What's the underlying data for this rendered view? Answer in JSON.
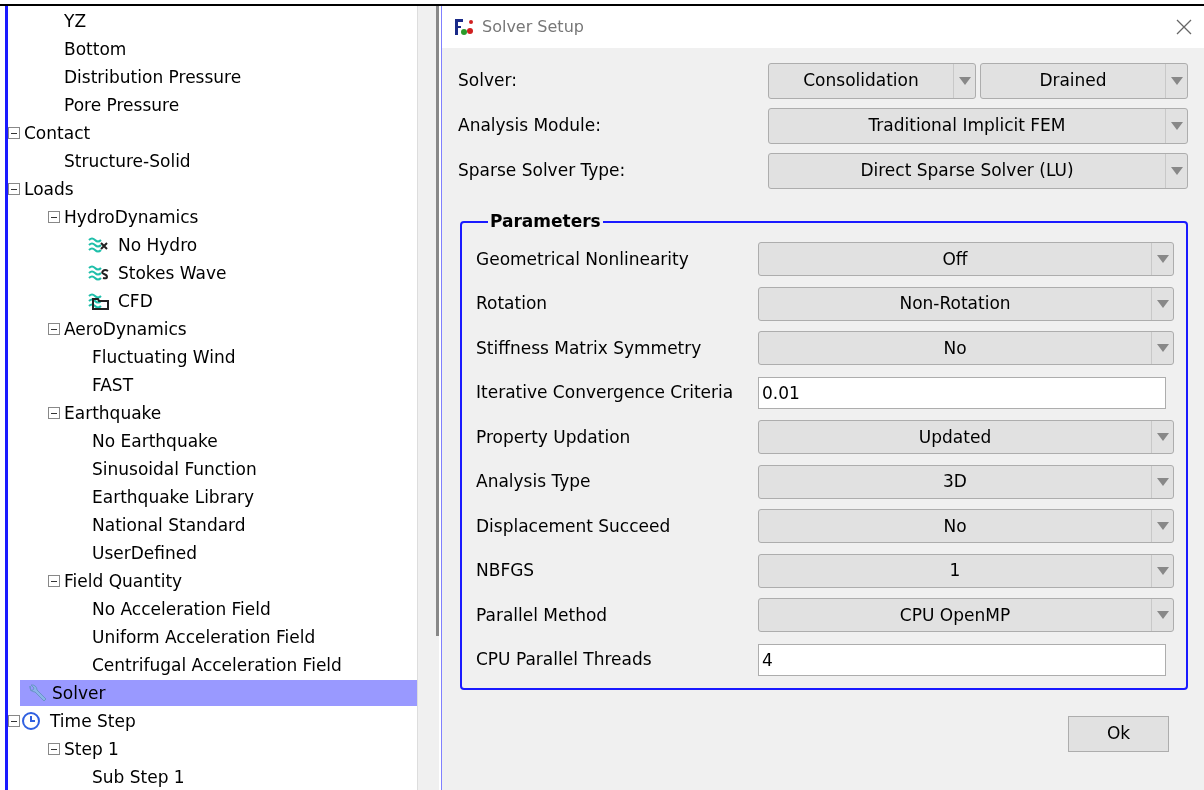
{
  "tree": [
    {
      "children": [
        {
          "label": "YZ",
          "selected": false
        },
        {
          "label": "Bottom",
          "selected": false
        },
        {
          "label": "Distribution Pressure",
          "selected": false
        },
        {
          "label": "Pore Pressure",
          "selected": false
        }
      ]
    },
    {
      "label": "Contact",
      "selected": false,
      "expanded": true,
      "children": [
        {
          "label": "Structure-Solid",
          "selected": false
        }
      ]
    },
    {
      "label": "Loads",
      "selected": false,
      "expanded": true,
      "children": [
        {
          "label": "HydroDynamics",
          "selected": false,
          "expanded": true,
          "children": [
            {
              "label": "No Hydro",
              "kind": "nohydro",
              "selected": false
            },
            {
              "label": "Stokes Wave",
              "kind": "stokes",
              "selected": false
            },
            {
              "label": "CFD",
              "kind": "cfd",
              "selected": false
            }
          ]
        },
        {
          "label": "AeroDynamics",
          "selected": false,
          "expanded": true,
          "children": [
            {
              "label": "Fluctuating Wind",
              "selected": false
            },
            {
              "label": "FAST",
              "selected": false
            }
          ]
        },
        {
          "label": "Earthquake",
          "selected": false,
          "expanded": true,
          "children": [
            {
              "label": "No Earthquake",
              "selected": false
            },
            {
              "label": "Sinusoidal Function",
              "selected": false
            },
            {
              "label": "Earthquake Library",
              "selected": false
            },
            {
              "label": "National Standard",
              "selected": false
            },
            {
              "label": "UserDefined",
              "selected": false
            }
          ]
        },
        {
          "label": "Field Quantity",
          "selected": false,
          "expanded": true,
          "children": [
            {
              "label": "No Acceleration Field",
              "selected": false
            },
            {
              "label": "Uniform Acceleration Field",
              "selected": false
            },
            {
              "label": "Centrifugal Acceleration Field",
              "selected": false
            }
          ]
        }
      ]
    },
    {
      "label": "Solver",
      "kind": "solver",
      "selected": true
    },
    {
      "label": "Time Step",
      "kind": "timestep",
      "selected": false,
      "expanded": true,
      "children": [
        {
          "label": "Step 1",
          "selected": false,
          "expanded": true,
          "children": [
            {
              "label": "Sub Step 1",
              "selected": false
            }
          ]
        }
      ]
    }
  ],
  "dialog": {
    "title": "Solver Setup",
    "rows": [
      {
        "label": "Solver:",
        "selects": [
          "Consolidation",
          "Drained"
        ]
      },
      {
        "label": "Analysis Module:",
        "selects": [
          "Traditional Implicit FEM"
        ]
      },
      {
        "label": "Sparse Solver Type:",
        "selects": [
          "Direct Sparse Solver (LU)"
        ]
      }
    ],
    "parameters": {
      "title": "Parameters",
      "fields": [
        {
          "label": "Geometrical Nonlinearity",
          "kind": "select",
          "value": "Off"
        },
        {
          "label": "Rotation",
          "kind": "select",
          "value": "Non-Rotation"
        },
        {
          "label": "Stiffness Matrix Symmetry",
          "kind": "select",
          "value": "No"
        },
        {
          "label": "Iterative Convergence Criteria",
          "kind": "input",
          "value": "0.01"
        },
        {
          "label": "Property Updation",
          "kind": "select",
          "value": "Updated"
        },
        {
          "label": "Analysis Type",
          "kind": "select",
          "value": "3D"
        },
        {
          "label": "Displacement Succeed",
          "kind": "select",
          "value": "No"
        },
        {
          "label": "NBFGS",
          "kind": "select",
          "value": "1"
        },
        {
          "label": "Parallel Method",
          "kind": "select",
          "value": "CPU OpenMP"
        },
        {
          "label": "CPU Parallel Threads",
          "kind": "input",
          "value": "4"
        }
      ]
    },
    "ok_button": "Ok"
  }
}
